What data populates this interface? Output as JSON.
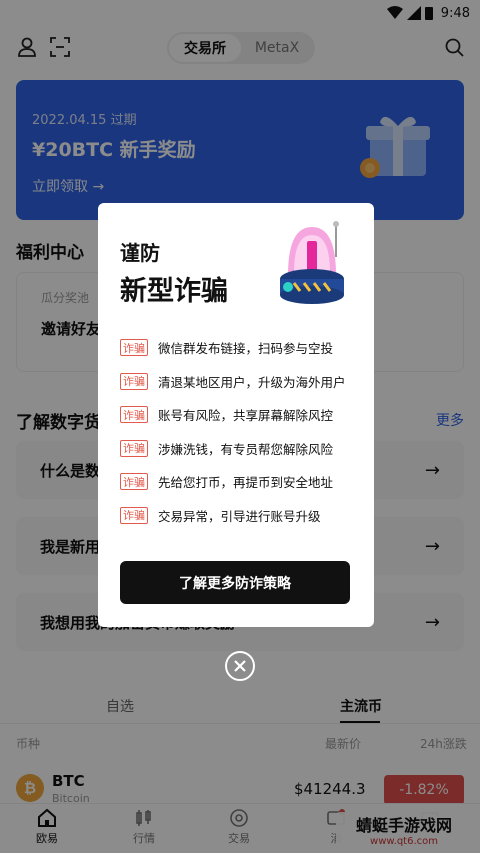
{
  "status_bar": {
    "time": "9:48"
  },
  "header": {
    "tabs": [
      {
        "label": "交易所"
      },
      {
        "label": "MetaX"
      }
    ]
  },
  "banner": {
    "date": "2022.04.15 过期",
    "title": "¥20BTC 新手奖励",
    "cta": "立即领取 →"
  },
  "welfare": {
    "title": "福利中心",
    "subtitle": "瓜分奖池",
    "text": "邀请好友……务即可获得免费金】！"
  },
  "learn": {
    "title": "了解数字货",
    "more": "更多",
    "items": [
      {
        "label": "什么是数"
      },
      {
        "label": "我是新用"
      },
      {
        "label": "我想用我的加密货币赚取奖励"
      }
    ]
  },
  "market": {
    "tabs": [
      {
        "label": "自选"
      },
      {
        "label": "主流币"
      }
    ],
    "columns": {
      "coin": "币种",
      "price": "最新价",
      "change": "24h涨跌"
    },
    "rows": [
      {
        "symbol": "BTC",
        "name": "Bitcoin",
        "price": "$41244.3",
        "change": "-1.82%",
        "icon_glyph": "₿"
      }
    ]
  },
  "bottom_nav": {
    "items": [
      {
        "label": "欧易"
      },
      {
        "label": "行情"
      },
      {
        "label": "交易"
      },
      {
        "label": "消"
      },
      {
        "label": ""
      }
    ]
  },
  "watermark": {
    "text": "蜻蜓手游戏网",
    "url": "www.qt6.com"
  },
  "modal": {
    "title_line1": "谨防",
    "title_line2": "新型诈骗",
    "tag": "诈骗",
    "warnings": [
      "微信群发布链接，扫码参与空投",
      "清退某地区用户，升级为海外用户",
      "账号有风险，共享屏幕解除风控",
      "涉嫌洗钱，有专员帮您解除风险",
      "先给您打币，再提币到安全地址",
      "交易异常，引导进行账号升级"
    ],
    "cta": "了解更多防诈策略"
  },
  "colors": {
    "accent_blue": "#2f63e6",
    "warning_red": "#e25a4b",
    "down_red": "#e24f4f"
  }
}
